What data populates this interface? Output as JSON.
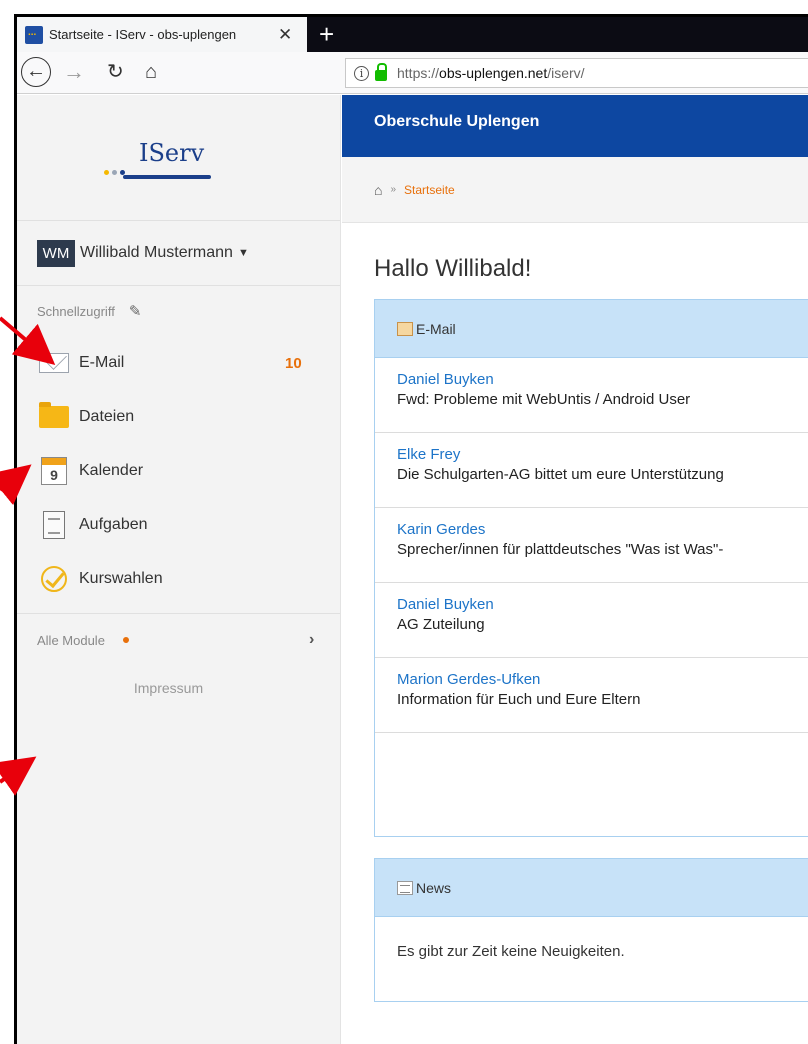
{
  "browser": {
    "tab_title": "Startseite - IServ - obs-uplengen",
    "url_prefix": "https://",
    "url_host": "obs-uplengen.net",
    "url_path": "/iserv/"
  },
  "sidebar": {
    "logo_text": "IServ",
    "user_initials": "WM",
    "user_name": "Willibald Mustermann",
    "quick_access": "Schnellzugriff",
    "items": [
      {
        "label": "E-Mail",
        "badge": "10"
      },
      {
        "label": "Dateien"
      },
      {
        "label": "Kalender",
        "icon_day": "9"
      },
      {
        "label": "Aufgaben"
      },
      {
        "label": "Kurswahlen"
      }
    ],
    "all_modules": "Alle Module",
    "impressum": "Impressum"
  },
  "header": {
    "school": "Oberschule Uplengen",
    "breadcrumb": "Startseite"
  },
  "main": {
    "greeting": "Hallo Willibald!",
    "mail_panel_title": "E-Mail",
    "mails": [
      {
        "from": "Daniel Buyken",
        "subject": "Fwd: Probleme mit WebUntis / Android User"
      },
      {
        "from": "Elke Frey",
        "subject": "Die Schulgarten-AG bittet um eure Unterstützung"
      },
      {
        "from": "Karin Gerdes",
        "subject": "Sprecher/innen für plattdeutsches \"Was ist Was\"-"
      },
      {
        "from": "Daniel Buyken",
        "subject": "AG Zuteilung"
      },
      {
        "from": "Marion Gerdes-Ufken",
        "subject": "Information für Euch und Eure Eltern"
      }
    ],
    "news_panel_title": "News",
    "news_empty": "Es gibt zur Zeit keine Neuigkeiten."
  },
  "colors": {
    "brand_blue": "#0d47a1",
    "accent_orange": "#e8700b",
    "panel_head": "#c7e2f8",
    "link_blue": "#1d74c8",
    "annotation_red": "#e8000b"
  }
}
